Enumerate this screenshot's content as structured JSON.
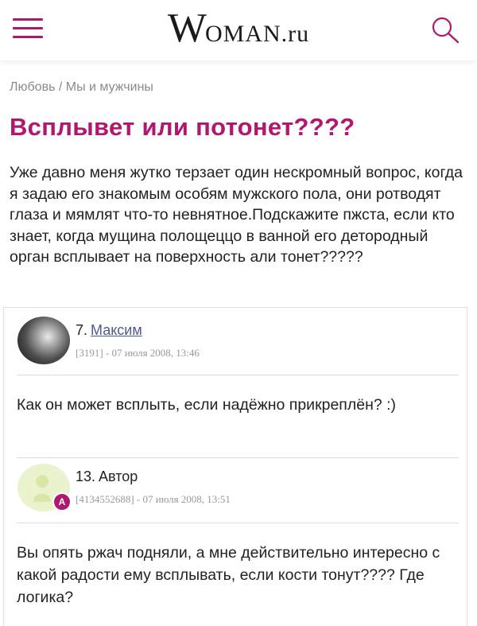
{
  "header": {
    "logo_big": "W",
    "logo_caps": "OMAN",
    "logo_suffix": ".ru",
    "menu_icon": "hamburger-menu-icon",
    "search_icon": "search-icon",
    "accent_color": "#b0176f"
  },
  "breadcrumb": {
    "items": [
      "Любовь",
      "Мы и мужчины"
    ],
    "separator": " / "
  },
  "article": {
    "title": "Всплывет или потонет????",
    "body": "Уже давно меня жутко терзает один нескромный вопрос, когда я задаю его знакомым особям мужского пола, они ротводят глаза и мямлят что-то невнятное.Подскажите пжста, если кто знает, когда мущина полощеццо в ванной его детородный орган всплывает на поверхность али тонет?????"
  },
  "comments": [
    {
      "number": "7.",
      "author": "Максим",
      "meta": "[3191] - 07 июля 2008, 13:46",
      "text": "Как он может всплыть, если надёжно прикреплён? :)"
    },
    {
      "number": "13.",
      "author": "Автор",
      "badge": "А",
      "meta": "[4134552688] - 07 июля 2008, 13:51",
      "text": "Вы опять ржач подняли, а мне действительно интересно с какой радости ему всплывать, если кости тонут???? Где логика?"
    }
  ]
}
